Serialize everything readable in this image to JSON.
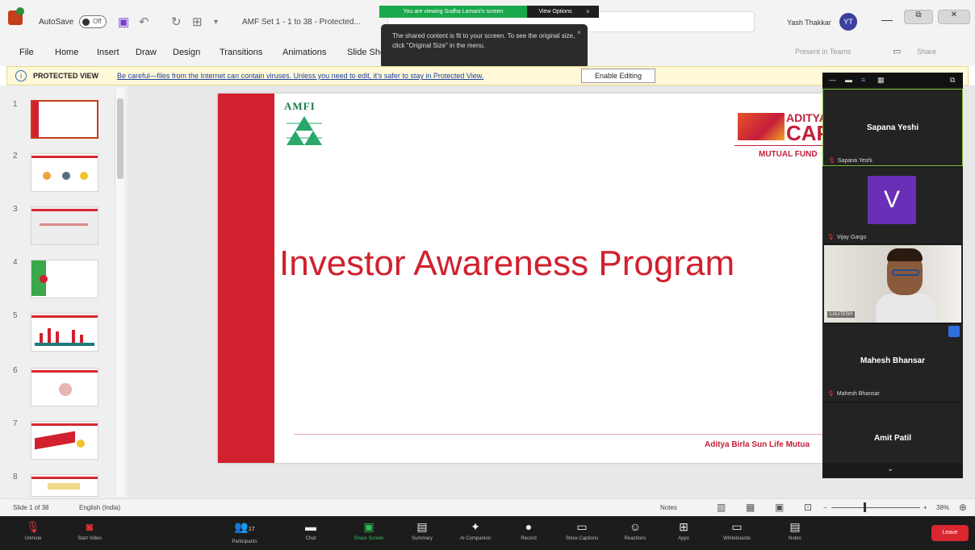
{
  "titlebar": {
    "autosave_label": "AutoSave",
    "autosave_state": "Off",
    "doc_title": "AMF Set 1 - 1 to 38 - Protected...",
    "user_name": "Yash Thakkar",
    "user_initials": "YT",
    "share_banner": "You are viewing Sudha Lamani's screen",
    "share_options": "View Options",
    "share_close": "×"
  },
  "tooltip": {
    "text": "The shared content is fit to your screen. To see the original size, click \"Original Size\" in the menu.",
    "close": "×"
  },
  "menu": {
    "items": [
      "File",
      "Home",
      "Insert",
      "Draw",
      "Design",
      "Transitions",
      "Animations",
      "Slide Show"
    ],
    "present_teams": "Present in Teams",
    "share": "Share"
  },
  "protected_view": {
    "label": "PROTECTED VIEW",
    "message": "Be careful—files from the Internet can contain viruses. Unless you need to edit, it's safer to stay in Protected View.",
    "enable_button": "Enable Editing"
  },
  "thumbnails": {
    "numbers": [
      "1",
      "2",
      "3",
      "4",
      "5",
      "6",
      "7",
      "8"
    ]
  },
  "slide": {
    "amfi_logo_text": "AMFI",
    "brand_line1": "ADITYA",
    "brand_line2": "CAPI",
    "brand_sub": "MUTUAL FUND",
    "title": "Investor Awareness Program",
    "footer": "Aditya Birla Sun Life Mutua"
  },
  "video_panel": {
    "participants": [
      {
        "name": "Sapana Yeshi",
        "label": "Sapana Yeshi"
      },
      {
        "name": "V",
        "label": "Vijay Gargo"
      },
      {
        "name": "",
        "label": "LALITESH"
      },
      {
        "name": "Mahesh Bhansar",
        "label": "Mahesh Bhansar"
      },
      {
        "name": "Amit Patil",
        "label": ""
      }
    ]
  },
  "statusbar": {
    "slide_info": "Slide 1 of 38",
    "language": "English (India)",
    "notes": "Notes",
    "zoom": "38%"
  },
  "meeting_toolbar": {
    "items": [
      {
        "label": "Unmute",
        "icon": "mic-off-icon"
      },
      {
        "label": "Start Video",
        "icon": "video-off-icon"
      },
      {
        "label": "Participants",
        "icon": "participants-icon",
        "count": "17"
      },
      {
        "label": "Chat",
        "icon": "chat-icon"
      },
      {
        "label": "Share Screen",
        "icon": "share-screen-icon"
      },
      {
        "label": "Summary",
        "icon": "summary-icon"
      },
      {
        "label": "AI Companion",
        "icon": "ai-companion-icon"
      },
      {
        "label": "Record",
        "icon": "record-icon"
      },
      {
        "label": "Show Captions",
        "icon": "captions-icon"
      },
      {
        "label": "Reactions",
        "icon": "reactions-icon"
      },
      {
        "label": "Apps",
        "icon": "apps-icon"
      },
      {
        "label": "Whiteboards",
        "icon": "whiteboard-icon"
      },
      {
        "label": "Notes",
        "icon": "notes-icon"
      }
    ],
    "leave": "Leave"
  },
  "colors": {
    "slide_red": "#d1202e",
    "zoom_green": "#19a84b",
    "leave_red": "#d9262f"
  }
}
